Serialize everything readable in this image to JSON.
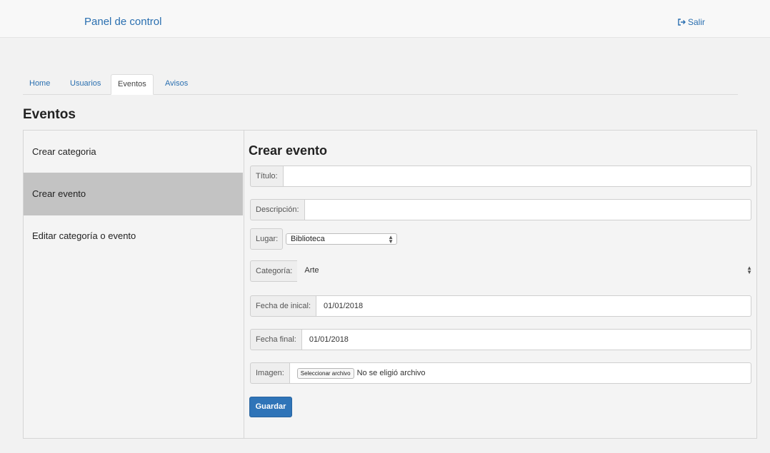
{
  "navbar": {
    "brand": "Panel de control",
    "logout_label": "Salir",
    "logout_icon": "sign-out-icon",
    "accent_color": "#2a6fb0"
  },
  "tabs": [
    {
      "label": "Home",
      "active": false
    },
    {
      "label": "Usuarios",
      "active": false
    },
    {
      "label": "Eventos",
      "active": true
    },
    {
      "label": "Avisos",
      "active": false
    }
  ],
  "page_title": "Eventos",
  "sidebar": {
    "items": [
      {
        "label": "Crear categoria",
        "active": false
      },
      {
        "label": "Crear evento",
        "active": true
      },
      {
        "label": "Editar categoría o evento",
        "active": false
      }
    ]
  },
  "form": {
    "title": "Crear evento",
    "titulo": {
      "label": "Título:",
      "value": ""
    },
    "descripcion": {
      "label": "Descripción:",
      "value": ""
    },
    "lugar": {
      "label": "Lugar:",
      "selected": "Biblioteca"
    },
    "categoria": {
      "label": "Categoría:",
      "selected": "Arte"
    },
    "fecha_inicial": {
      "label": "Fecha de inical:",
      "value": "01/01/2018"
    },
    "fecha_final": {
      "label": "Fecha final:",
      "value": "01/01/2018"
    },
    "imagen": {
      "label": "Imagen:",
      "button": "Seleccionar archivo",
      "status": "No se eligió archivo"
    },
    "save_label": "Guardar",
    "save_color": "#2f74b8"
  }
}
